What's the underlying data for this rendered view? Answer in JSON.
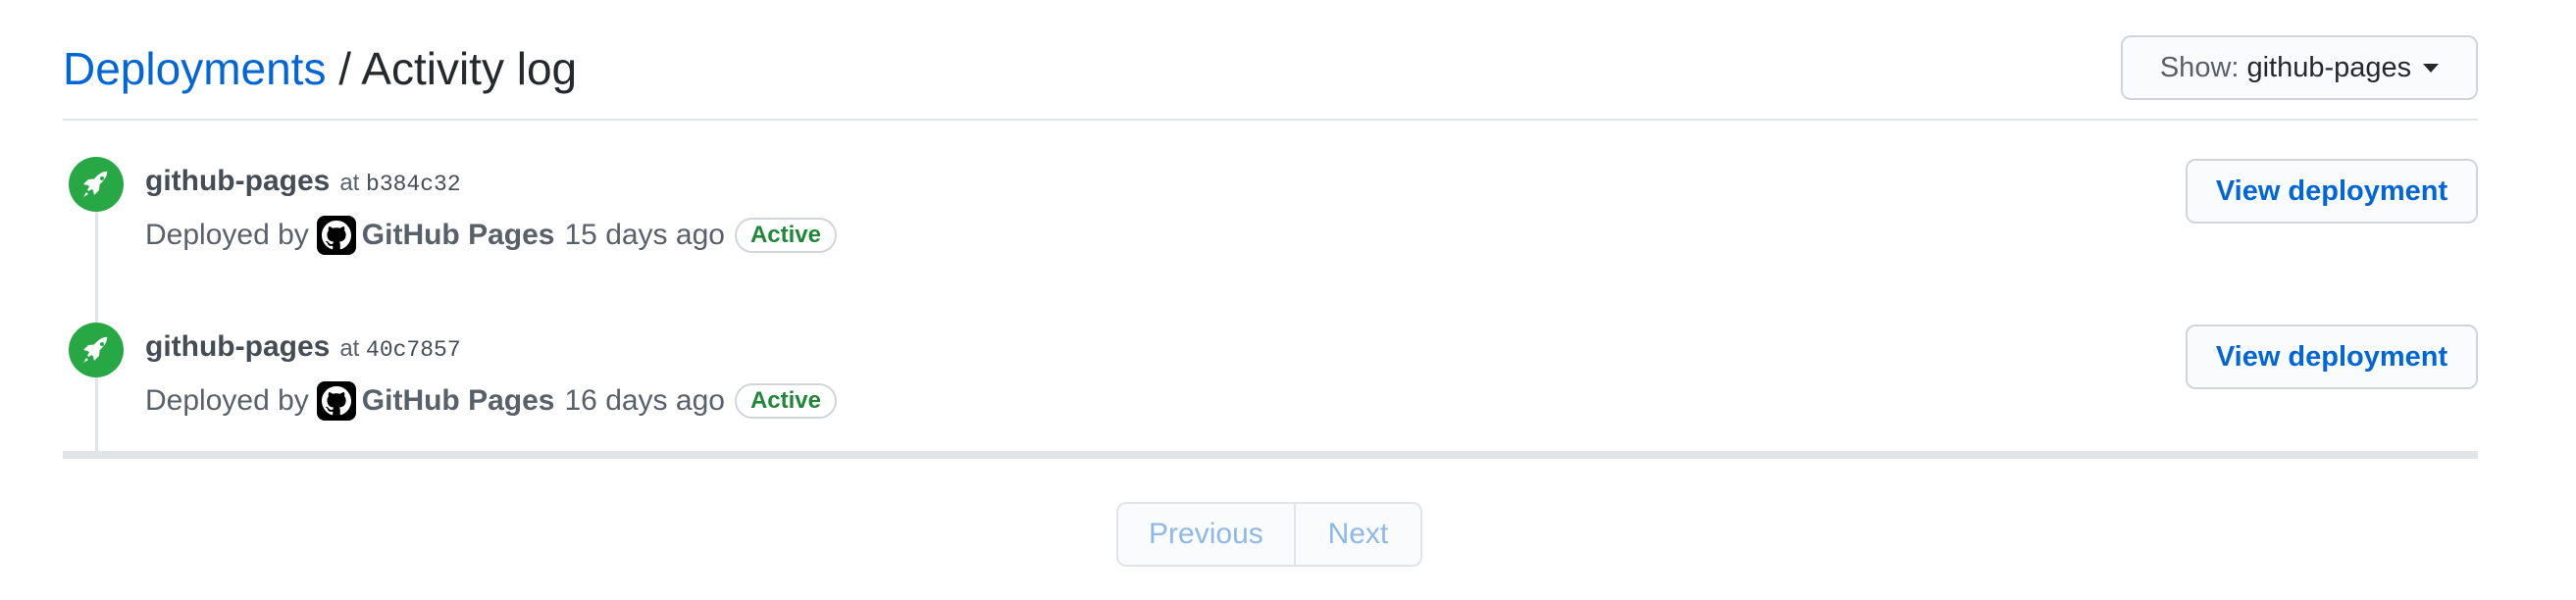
{
  "header": {
    "breadcrumb_link": "Deployments",
    "separator": " / ",
    "title": "Activity log",
    "show_label": "Show:",
    "show_value": "github-pages"
  },
  "deployments": [
    {
      "environment": "github-pages",
      "at_text": "at",
      "sha": "b384c32",
      "deployed_by_text": "Deployed by",
      "actor": "GitHub Pages",
      "time": "15 days ago",
      "status": "Active",
      "button": "View deployment"
    },
    {
      "environment": "github-pages",
      "at_text": "at",
      "sha": "40c7857",
      "deployed_by_text": "Deployed by",
      "actor": "GitHub Pages",
      "time": "16 days ago",
      "status": "Active",
      "button": "View deployment"
    }
  ],
  "pagination": {
    "previous": "Previous",
    "next": "Next"
  },
  "colors": {
    "link": "#0366d6",
    "success": "#28a745",
    "active_text": "#22863a",
    "disabled_link": "#8eb8e8"
  },
  "icons": {
    "deployment": "rocket-icon",
    "actor_avatar": "github-logo",
    "dropdown": "caret-down-icon"
  }
}
